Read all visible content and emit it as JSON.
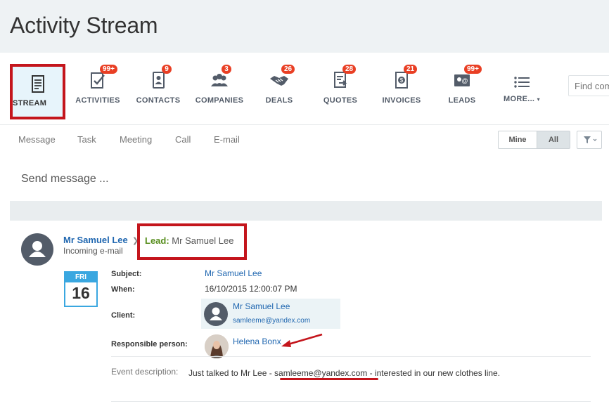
{
  "header": {
    "title": "Activity Stream"
  },
  "toolbar": {
    "items": [
      {
        "label": "STREAM",
        "badge": ""
      },
      {
        "label": "ACTIVITIES",
        "badge": "99+"
      },
      {
        "label": "CONTACTS",
        "badge": "9"
      },
      {
        "label": "COMPANIES",
        "badge": "3"
      },
      {
        "label": "DEALS",
        "badge": "26"
      },
      {
        "label": "QUOTES",
        "badge": "28"
      },
      {
        "label": "INVOICES",
        "badge": "21"
      },
      {
        "label": "LEADS",
        "badge": "99+"
      },
      {
        "label": "MORE...",
        "badge": ""
      }
    ],
    "find_placeholder": "Find com"
  },
  "post_tabs": [
    "Message",
    "Task",
    "Meeting",
    "Call",
    "E-mail"
  ],
  "filter": {
    "mine": "Mine",
    "all": "All"
  },
  "composer": {
    "placeholder": "Send message ..."
  },
  "post": {
    "author": "Mr Samuel Lee",
    "type": "Incoming e-mail",
    "lead_label": "Lead:",
    "lead_name": "Mr Samuel Lee",
    "calendar": {
      "weekday": "FRI",
      "day": "16"
    },
    "fields": {
      "subject_label": "Subject:",
      "subject": "Mr Samuel Lee",
      "when_label": "When:",
      "when": "16/10/2015 12:00:07 PM",
      "client_label": "Client:",
      "client_name": "Mr Samuel Lee",
      "client_email": "samleeme@yandex.com",
      "responsible_label": "Responsible person:",
      "responsible": "Helena Bonx",
      "event_label": "Event description:",
      "event_text": "Just talked to Mr Lee - samleeme@yandex.com - interested in our new clothes line."
    }
  },
  "colors": {
    "accent": "#2067b0",
    "badge": "#e93f24",
    "highlight": "#c4151c",
    "lead": "#578e1d"
  }
}
